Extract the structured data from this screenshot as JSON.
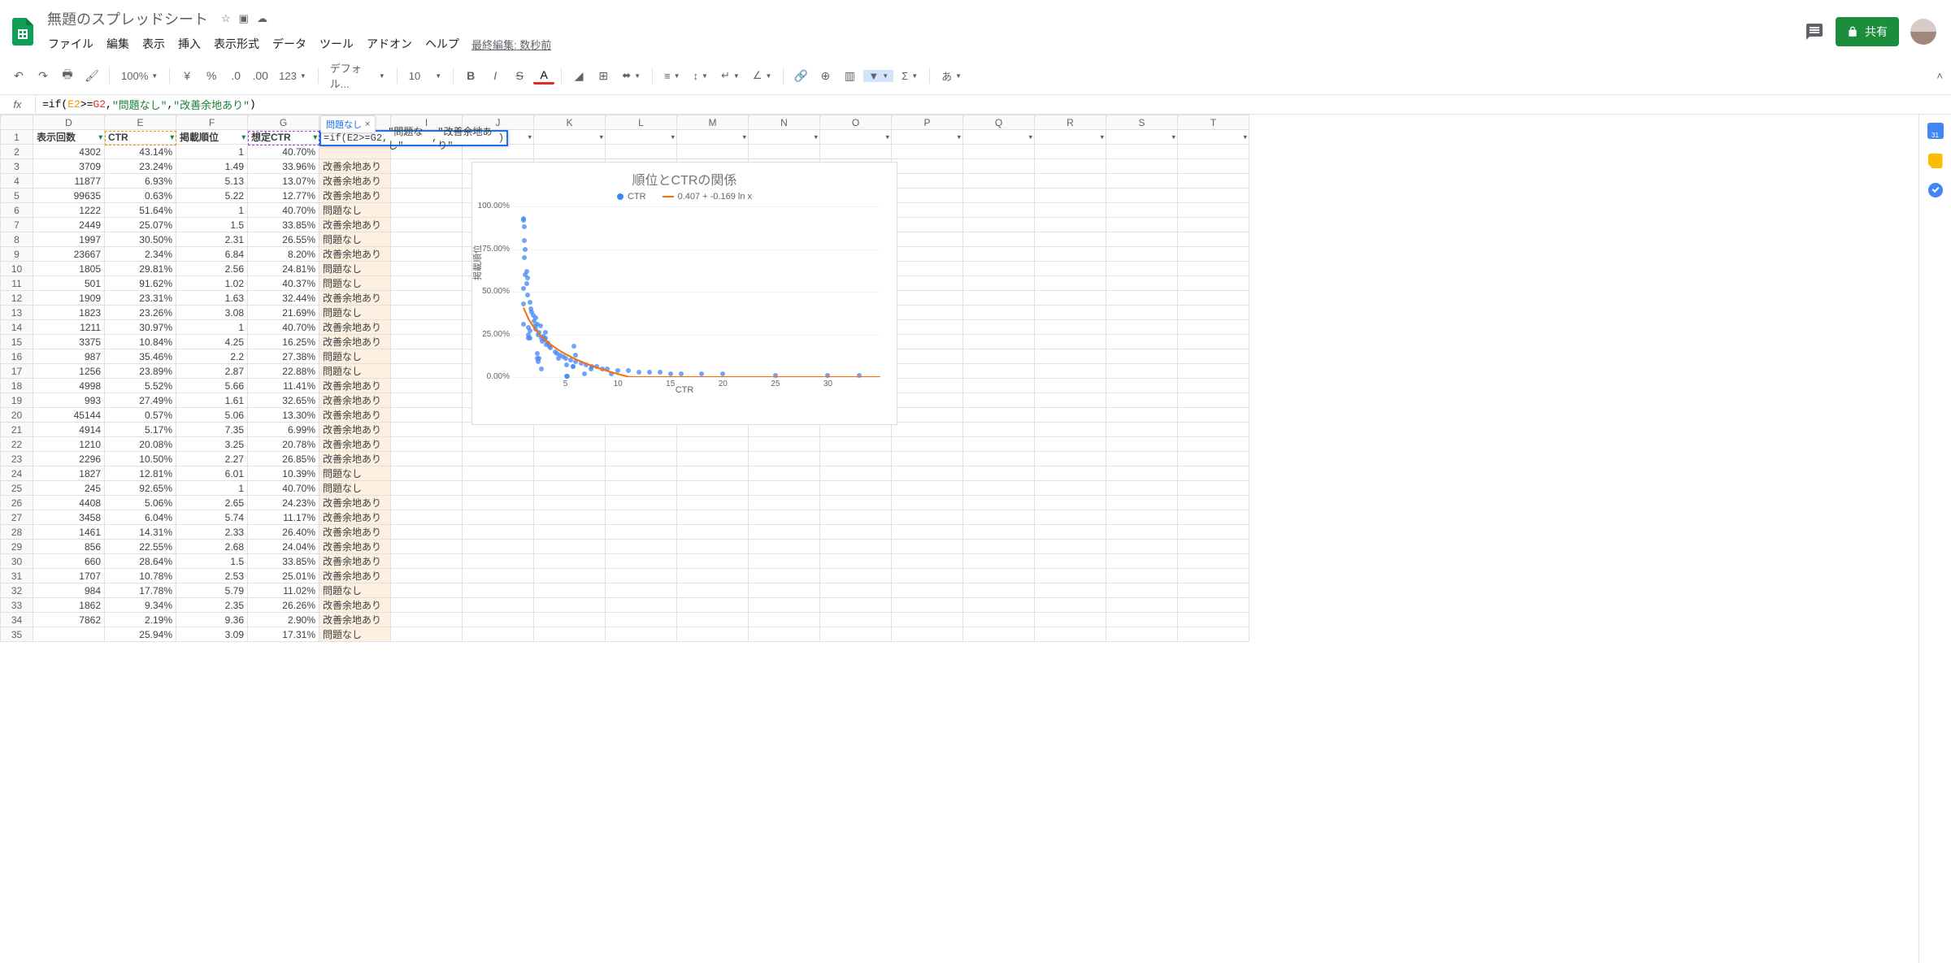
{
  "header": {
    "doc_title": "無題のスプレッドシート",
    "menubar": [
      "ファイル",
      "編集",
      "表示",
      "挿入",
      "表示形式",
      "データ",
      "ツール",
      "アドオン",
      "ヘルプ"
    ],
    "last_edit": "最終編集: 数秒前",
    "share_label": "共有"
  },
  "toolbar": {
    "zoom": "100%",
    "decimals": [
      ".0",
      ".00"
    ],
    "num_format": "123",
    "font": "デフォル...",
    "font_size": "10",
    "input_mode": "あ"
  },
  "formula_bar": {
    "fx": "fx",
    "prefix": "=if(",
    "ref1": "E2",
    "op": ">=",
    "ref2": "G2",
    "sep": ",",
    "str1": "\"問題なし\"",
    "str2": "\"改善余地あり\"",
    "suffix": ")"
  },
  "result_hint": "問題なし",
  "column_letters": [
    "D",
    "E",
    "F",
    "G",
    "H",
    "I",
    "J",
    "K",
    "L",
    "M",
    "N",
    "O",
    "P",
    "Q",
    "R",
    "S",
    "T"
  ],
  "headers_row": [
    "表示回数",
    "CTR",
    "掲載順位",
    "想定CTR",
    ""
  ],
  "rows": [
    {
      "n": 2,
      "d": "4302",
      "e": "43.14%",
      "f": "1",
      "g": "40.70%",
      "h": ""
    },
    {
      "n": 3,
      "d": "3709",
      "e": "23.24%",
      "f": "1.49",
      "g": "33.96%",
      "h": "改善余地あり"
    },
    {
      "n": 4,
      "d": "11877",
      "e": "6.93%",
      "f": "5.13",
      "g": "13.07%",
      "h": "改善余地あり"
    },
    {
      "n": 5,
      "d": "99635",
      "e": "0.63%",
      "f": "5.22",
      "g": "12.77%",
      "h": "改善余地あり"
    },
    {
      "n": 6,
      "d": "1222",
      "e": "51.64%",
      "f": "1",
      "g": "40.70%",
      "h": "問題なし"
    },
    {
      "n": 7,
      "d": "2449",
      "e": "25.07%",
      "f": "1.5",
      "g": "33.85%",
      "h": "改善余地あり"
    },
    {
      "n": 8,
      "d": "1997",
      "e": "30.50%",
      "f": "2.31",
      "g": "26.55%",
      "h": "問題なし"
    },
    {
      "n": 9,
      "d": "23667",
      "e": "2.34%",
      "f": "6.84",
      "g": "8.20%",
      "h": "改善余地あり"
    },
    {
      "n": 10,
      "d": "1805",
      "e": "29.81%",
      "f": "2.56",
      "g": "24.81%",
      "h": "問題なし"
    },
    {
      "n": 11,
      "d": "501",
      "e": "91.62%",
      "f": "1.02",
      "g": "40.37%",
      "h": "問題なし"
    },
    {
      "n": 12,
      "d": "1909",
      "e": "23.31%",
      "f": "1.63",
      "g": "32.44%",
      "h": "改善余地あり"
    },
    {
      "n": 13,
      "d": "1823",
      "e": "23.26%",
      "f": "3.08",
      "g": "21.69%",
      "h": "問題なし"
    },
    {
      "n": 14,
      "d": "1211",
      "e": "30.97%",
      "f": "1",
      "g": "40.70%",
      "h": "改善余地あり"
    },
    {
      "n": 15,
      "d": "3375",
      "e": "10.84%",
      "f": "4.25",
      "g": "16.25%",
      "h": "改善余地あり"
    },
    {
      "n": 16,
      "d": "987",
      "e": "35.46%",
      "f": "2.2",
      "g": "27.38%",
      "h": "問題なし"
    },
    {
      "n": 17,
      "d": "1256",
      "e": "23.89%",
      "f": "2.87",
      "g": "22.88%",
      "h": "問題なし"
    },
    {
      "n": 18,
      "d": "4998",
      "e": "5.52%",
      "f": "5.66",
      "g": "11.41%",
      "h": "改善余地あり"
    },
    {
      "n": 19,
      "d": "993",
      "e": "27.49%",
      "f": "1.61",
      "g": "32.65%",
      "h": "改善余地あり"
    },
    {
      "n": 20,
      "d": "45144",
      "e": "0.57%",
      "f": "5.06",
      "g": "13.30%",
      "h": "改善余地あり"
    },
    {
      "n": 21,
      "d": "4914",
      "e": "5.17%",
      "f": "7.35",
      "g": "6.99%",
      "h": "改善余地あり"
    },
    {
      "n": 22,
      "d": "1210",
      "e": "20.08%",
      "f": "3.25",
      "g": "20.78%",
      "h": "改善余地あり"
    },
    {
      "n": 23,
      "d": "2296",
      "e": "10.50%",
      "f": "2.27",
      "g": "26.85%",
      "h": "改善余地あり"
    },
    {
      "n": 24,
      "d": "1827",
      "e": "12.81%",
      "f": "6.01",
      "g": "10.39%",
      "h": "問題なし"
    },
    {
      "n": 25,
      "d": "245",
      "e": "92.65%",
      "f": "1",
      "g": "40.70%",
      "h": "問題なし"
    },
    {
      "n": 26,
      "d": "4408",
      "e": "5.06%",
      "f": "2.65",
      "g": "24.23%",
      "h": "改善余地あり"
    },
    {
      "n": 27,
      "d": "3458",
      "e": "6.04%",
      "f": "5.74",
      "g": "11.17%",
      "h": "改善余地あり"
    },
    {
      "n": 28,
      "d": "1461",
      "e": "14.31%",
      "f": "2.33",
      "g": "26.40%",
      "h": "改善余地あり"
    },
    {
      "n": 29,
      "d": "856",
      "e": "22.55%",
      "f": "2.68",
      "g": "24.04%",
      "h": "改善余地あり"
    },
    {
      "n": 30,
      "d": "660",
      "e": "28.64%",
      "f": "1.5",
      "g": "33.85%",
      "h": "改善余地あり"
    },
    {
      "n": 31,
      "d": "1707",
      "e": "10.78%",
      "f": "2.53",
      "g": "25.01%",
      "h": "改善余地あり"
    },
    {
      "n": 32,
      "d": "984",
      "e": "17.78%",
      "f": "5.79",
      "g": "11.02%",
      "h": "問題なし"
    },
    {
      "n": 33,
      "d": "1862",
      "e": "9.34%",
      "f": "2.35",
      "g": "26.26%",
      "h": "改善余地あり"
    },
    {
      "n": 34,
      "d": "7862",
      "e": "2.19%",
      "f": "9.36",
      "g": "2.90%",
      "h": "改善余地あり"
    },
    {
      "n": 35,
      "d": "",
      "e": "25.94%",
      "f": "3.09",
      "g": "17.31%",
      "h": "問題なし"
    }
  ],
  "chart_data": {
    "type": "scatter",
    "title": "順位とCTRの関係",
    "xlabel": "CTR",
    "ylabel": "掲載順位",
    "legend": [
      "CTR",
      "0.407 + -0.169 ln x"
    ],
    "x_ticks": [
      "5",
      "10",
      "15",
      "20",
      "25",
      "30"
    ],
    "y_ticks": [
      "0.00%",
      "25.00%",
      "50.00%",
      "75.00%",
      "100.00%"
    ],
    "xlim": [
      0,
      35
    ],
    "ylim": [
      0,
      100
    ],
    "trend": {
      "a": 0.407,
      "b": -0.169
    },
    "points": [
      [
        1,
        43
      ],
      [
        1.5,
        23
      ],
      [
        5.1,
        7
      ],
      [
        5.2,
        0.6
      ],
      [
        1,
        52
      ],
      [
        1.5,
        25
      ],
      [
        2.3,
        31
      ],
      [
        6.8,
        2
      ],
      [
        2.6,
        30
      ],
      [
        1,
        92
      ],
      [
        1.6,
        23
      ],
      [
        3.1,
        23
      ],
      [
        1,
        31
      ],
      [
        4.3,
        11
      ],
      [
        2.2,
        35
      ],
      [
        2.9,
        24
      ],
      [
        5.7,
        6
      ],
      [
        1.6,
        27
      ],
      [
        5.1,
        0.6
      ],
      [
        7.4,
        5
      ],
      [
        3.3,
        20
      ],
      [
        2.3,
        11
      ],
      [
        6,
        13
      ],
      [
        1,
        93
      ],
      [
        2.7,
        5
      ],
      [
        5.7,
        6
      ],
      [
        2.3,
        14
      ],
      [
        2.7,
        23
      ],
      [
        1.5,
        29
      ],
      [
        2.5,
        11
      ],
      [
        5.8,
        18
      ],
      [
        2.4,
        9
      ],
      [
        9.4,
        2
      ],
      [
        3.1,
        26
      ],
      [
        1.2,
        60
      ],
      [
        1.3,
        55
      ],
      [
        1.1,
        70
      ],
      [
        1.4,
        48
      ],
      [
        1.8,
        38
      ],
      [
        2,
        33
      ],
      [
        2.1,
        30
      ],
      [
        2.5,
        26
      ],
      [
        3,
        22
      ],
      [
        3.5,
        18
      ],
      [
        4,
        15
      ],
      [
        4.5,
        13
      ],
      [
        5,
        11
      ],
      [
        6,
        9
      ],
      [
        7,
        7
      ],
      [
        8,
        6
      ],
      [
        9,
        5
      ],
      [
        10,
        4
      ],
      [
        11,
        4
      ],
      [
        12,
        3
      ],
      [
        13,
        3
      ],
      [
        14,
        3
      ],
      [
        15,
        2
      ],
      [
        16,
        2
      ],
      [
        18,
        2
      ],
      [
        20,
        2
      ],
      [
        25,
        1
      ],
      [
        30,
        1
      ],
      [
        33,
        1
      ],
      [
        1.1,
        80
      ],
      [
        1.2,
        75
      ],
      [
        1.05,
        88
      ],
      [
        1.3,
        62
      ],
      [
        1.4,
        58
      ],
      [
        1.6,
        44
      ],
      [
        1.7,
        40
      ],
      [
        1.9,
        36
      ],
      [
        2.2,
        28
      ],
      [
        2.4,
        25
      ],
      [
        2.8,
        21
      ],
      [
        3.2,
        19
      ],
      [
        3.6,
        17
      ],
      [
        4.2,
        14
      ],
      [
        4.8,
        12
      ],
      [
        5.5,
        10
      ],
      [
        6.5,
        8
      ],
      [
        7.5,
        6
      ],
      [
        8.5,
        5
      ]
    ]
  },
  "side_panel": {
    "calendar_day": "31"
  }
}
